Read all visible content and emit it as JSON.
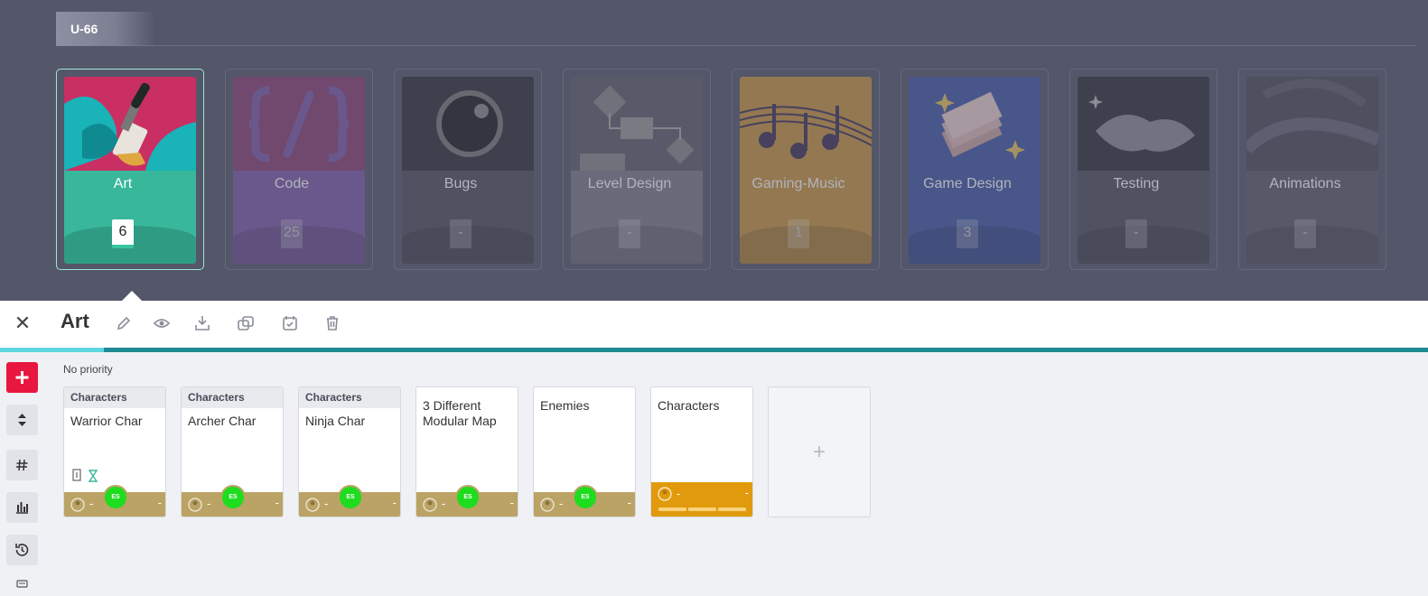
{
  "project": {
    "code": "U-66"
  },
  "categories": [
    {
      "name": "Art",
      "count": "6",
      "color": "#38b79b",
      "active": true
    },
    {
      "name": "Code",
      "count": "25",
      "color": "#7c5aa9"
    },
    {
      "name": "Bugs",
      "count": "-",
      "color": "#5f6170"
    },
    {
      "name": "Level Design",
      "count": "-",
      "color": "#7b7d8b"
    },
    {
      "name": "Gaming-Music",
      "count": "1",
      "color": "#c8943e"
    },
    {
      "name": "Game Design",
      "count": "3",
      "color": "#3f56a4"
    },
    {
      "name": "Testing",
      "count": "-",
      "color": "#5f6170"
    },
    {
      "name": "Animations",
      "count": "-",
      "color": "#6a6c7a"
    }
  ],
  "toolbar": {
    "title": "Art",
    "icons": [
      "close-icon",
      "pencil-icon",
      "eye-icon",
      "download-icon",
      "duplicate-icon",
      "calendar-icon",
      "trash-icon"
    ]
  },
  "rail": {
    "icons": [
      "plus-icon",
      "sort-icon",
      "hash-icon",
      "bar-chart-icon",
      "history-icon",
      "keyboard-icon"
    ]
  },
  "section": {
    "label": "No priority"
  },
  "tasks": [
    {
      "category": "Characters",
      "name": "Warrior Char",
      "dash_left": "-",
      "dash_right": "-",
      "assignee": "ES"
    },
    {
      "category": "Characters",
      "name": "Archer Char",
      "dash_left": "-",
      "dash_right": "-",
      "assignee": "ES"
    },
    {
      "category": "Characters",
      "name": "Ninja Char",
      "dash_left": "-",
      "dash_right": "-",
      "assignee": "ES"
    },
    {
      "category": "",
      "name": "3 Different Modular Map",
      "dash_left": "-",
      "dash_right": "-",
      "assignee": "ES"
    },
    {
      "category": "",
      "name": "Enemies",
      "dash_left": "-",
      "dash_right": "-",
      "assignee": "ES"
    },
    {
      "category": "",
      "name": "Characters",
      "dash_left": "-",
      "dash_right": "-",
      "assignee": ""
    }
  ],
  "add_task": {
    "label": "+"
  }
}
